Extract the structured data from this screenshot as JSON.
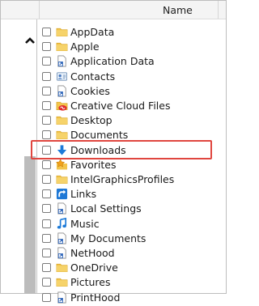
{
  "header": {
    "name_label": "Name"
  },
  "items": [
    {
      "label": "AppData",
      "icon": "folder-icon"
    },
    {
      "label": "Apple",
      "icon": "folder-icon"
    },
    {
      "label": "Application Data",
      "icon": "shortcut-file-icon"
    },
    {
      "label": "Contacts",
      "icon": "contacts-icon"
    },
    {
      "label": "Cookies",
      "icon": "shortcut-file-icon"
    },
    {
      "label": "Creative Cloud Files",
      "icon": "creative-cloud-folder-icon"
    },
    {
      "label": "Desktop",
      "icon": "folder-icon"
    },
    {
      "label": "Documents",
      "icon": "folder-icon"
    },
    {
      "label": "Downloads",
      "icon": "download-arrow-icon"
    },
    {
      "label": "Favorites",
      "icon": "favorites-star-icon"
    },
    {
      "label": "IntelGraphicsProfiles",
      "icon": "folder-icon"
    },
    {
      "label": "Links",
      "icon": "links-icon"
    },
    {
      "label": "Local Settings",
      "icon": "shortcut-file-icon"
    },
    {
      "label": "Music",
      "icon": "music-icon"
    },
    {
      "label": "My Documents",
      "icon": "shortcut-file-icon"
    },
    {
      "label": "NetHood",
      "icon": "shortcut-file-icon"
    },
    {
      "label": "OneDrive",
      "icon": "folder-icon"
    },
    {
      "label": "Pictures",
      "icon": "folder-icon"
    },
    {
      "label": "PrintHood",
      "icon": "shortcut-file-icon"
    }
  ],
  "colors": {
    "highlight": "#e0463f",
    "folder": "#f3c54c",
    "accent": "#1c7ad8"
  }
}
